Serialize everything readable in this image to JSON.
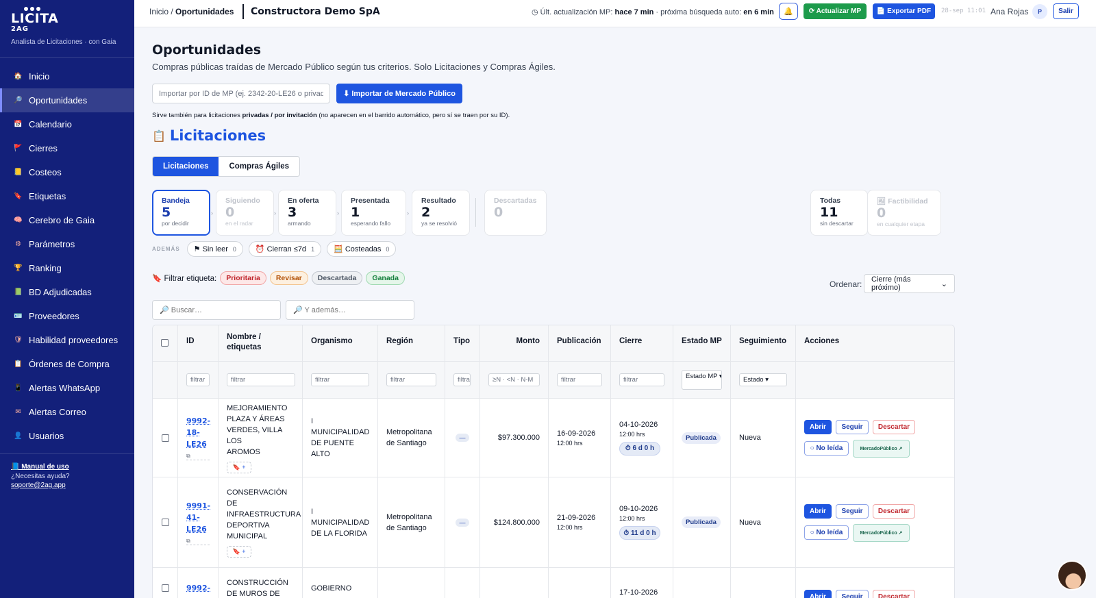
{
  "brand": {
    "name": "LICITA",
    "sub": "2AG",
    "tagline": "Analista de Licitaciones · con Gaia"
  },
  "sidebar": {
    "items": [
      {
        "label": "Inicio",
        "icon": "home-icon",
        "glyph": "🏠"
      },
      {
        "label": "Oportunidades",
        "icon": "search-icon",
        "glyph": "🔎",
        "active": true
      },
      {
        "label": "Calendario",
        "icon": "calendar-icon",
        "glyph": "📅"
      },
      {
        "label": "Cierres",
        "icon": "flag-icon",
        "glyph": "🚩"
      },
      {
        "label": "Costeos",
        "icon": "ledger-icon",
        "glyph": "📒"
      },
      {
        "label": "Etiquetas",
        "icon": "bookmark-icon",
        "glyph": "🔖"
      },
      {
        "label": "Cerebro de Gaia",
        "icon": "brain-icon",
        "glyph": "🧠"
      },
      {
        "label": "Parámetros",
        "icon": "gear-icon",
        "glyph": "⚙"
      },
      {
        "label": "Ranking",
        "icon": "trophy-icon",
        "glyph": "🏆"
      },
      {
        "label": "BD Adjudicadas",
        "icon": "document-icon",
        "glyph": "📗"
      },
      {
        "label": "Proveedores",
        "icon": "id-card-icon",
        "glyph": "🪪"
      },
      {
        "label": "Habilidad proveedores",
        "icon": "shield-icon",
        "glyph": "🛡"
      },
      {
        "label": "Órdenes de Compra",
        "icon": "receipt-icon",
        "glyph": "📋"
      },
      {
        "label": "Alertas WhatsApp",
        "icon": "phone-icon",
        "glyph": "📱"
      },
      {
        "label": "Alertas Correo",
        "icon": "mail-icon",
        "glyph": "✉"
      },
      {
        "label": "Usuarios",
        "icon": "user-icon",
        "glyph": "👤"
      }
    ],
    "footer": {
      "manual": "📘 Manual de uso",
      "help": "¿Necesitas ayuda?",
      "email": "soporte@2ag.app"
    }
  },
  "topbar": {
    "breadcrumb_home": "Inicio",
    "breadcrumb_sep": "/",
    "breadcrumb_current": "Oportunidades",
    "company": "Constructora Demo SpA",
    "update_prefix": "◷ Últ. actualización MP:",
    "update_ago": "hace 7 min",
    "update_mid": "· próxima búsqueda auto:",
    "update_next": "en 6 min",
    "bell": "🔔",
    "update_btn": "⟳ Actualizar MP",
    "export_btn": "📄 Exportar PDF",
    "clock": "28-sep 11:01",
    "user": "Ana Rojas",
    "avatar_initial": "P",
    "logout": "Salir"
  },
  "page": {
    "title": "Oportunidades",
    "subtitle": "Compras públicas traídas de Mercado Público según tus criterios. Solo Licitaciones y Compras Ágiles.",
    "import_placeholder": "Importar por ID de MP (ej. 2342-20-LE26 o privada",
    "import_btn": "⬇ Importar de Mercado Público",
    "help_pre": "Sirve también para licitaciones ",
    "help_bold": "privadas / por invitación",
    "help_post": " (no aparecen en el barrido automático, pero sí se traen por su ID).",
    "section_icon": "📋",
    "section_title": "Licitaciones",
    "tabs": [
      "Licitaciones",
      "Compras Ágiles"
    ]
  },
  "stages": [
    {
      "label": "Bandeja",
      "count": "5",
      "sub": "por decidir"
    },
    {
      "label": "Siguiendo",
      "count": "0",
      "sub": "en el radar"
    },
    {
      "label": "En oferta",
      "count": "3",
      "sub": "armando"
    },
    {
      "label": "Presentada",
      "count": "1",
      "sub": "esperando fallo"
    },
    {
      "label": "Resultado",
      "count": "2",
      "sub": "ya se resolvió"
    },
    {
      "label": "Descartadas",
      "count": "0",
      "sub": ""
    },
    {
      "label": "Todas",
      "count": "11",
      "sub": "sin descartar"
    },
    {
      "label": "🖼 Factibilidad",
      "count": "0",
      "sub": "en cualquier etapa"
    }
  ],
  "extras": {
    "label": "ADEMÁS",
    "pills": [
      {
        "label": "⚑ Sin leer",
        "count": "0"
      },
      {
        "label": "⏰ Cierran ≤7d",
        "count": "1"
      },
      {
        "label": "🧮 Costeadas",
        "count": "0"
      }
    ]
  },
  "tag_filter": {
    "label": "🔖 Filtrar etiqueta:",
    "tags": [
      "Prioritaria",
      "Revisar",
      "Descartada",
      "Ganada"
    ]
  },
  "order": {
    "label": "Ordenar:",
    "value": "Cierre (más próximo)"
  },
  "search": {
    "placeholder1": "🔎 Buscar…",
    "placeholder2": "🔎 Y además…"
  },
  "table": {
    "headers": [
      "ID",
      "Nombre / etiquetas",
      "Organismo",
      "Región",
      "Tipo",
      "Monto",
      "Publicación",
      "Cierre",
      "Estado MP",
      "Seguimiento",
      "Acciones"
    ],
    "filters": [
      "filtrar",
      "filtrar",
      "filtrar",
      "filtrar",
      "filtrar",
      "≥N · <N · N-M",
      "filtrar",
      "filtrar",
      "Estado MP ▾",
      "Estado ▾"
    ],
    "rows": [
      {
        "id_lines": [
          "9992-",
          "18-",
          "LE26"
        ],
        "name_lines": [
          "MEJORAMIENTO",
          "PLAZA Y ÁREAS",
          "VERDES, VILLA LOS",
          "AROMOS"
        ],
        "org_lines": [
          "I MUNICIPALIDAD",
          "DE PUENTE ALTO"
        ],
        "region_lines": [
          "Metropolitana",
          "de Santiago"
        ],
        "tipo": "—",
        "monto": "$97.300.000",
        "pub_date": "16-09-2026",
        "pub_time": "12:00 hrs",
        "close_date": "04-10-2026",
        "close_time": "12:00 hrs",
        "countdown": "⏱ 6 d 0 h",
        "estado": "Publicada",
        "seguimiento": "Nueva"
      },
      {
        "id_lines": [
          "9991-",
          "41-",
          "LE26"
        ],
        "name_lines": [
          "CONSERVACIÓN",
          "DE",
          "INFRAESTRUCTURA",
          "DEPORTIVA",
          "MUNICIPAL"
        ],
        "org_lines": [
          "I MUNICIPALIDAD",
          "DE LA FLORIDA"
        ],
        "region_lines": [
          "Metropolitana",
          "de Santiago"
        ],
        "tipo": "—",
        "monto": "$124.800.000",
        "pub_date": "21-09-2026",
        "pub_time": "12:00 hrs",
        "close_date": "09-10-2026",
        "close_time": "12:00 hrs",
        "countdown": "⏱ 11 d 0 h",
        "estado": "Publicada",
        "seguimiento": "Nueva"
      },
      {
        "id_lines": [
          "9992-"
        ],
        "name_lines": [
          "CONSTRUCCIÓN",
          "DE MUROS DE"
        ],
        "org_lines": [
          "GOBIERNO"
        ],
        "close_date": "17-10-2026"
      }
    ],
    "actions": {
      "open": "Abrir",
      "follow": "Seguir",
      "discard": "Descartar",
      "unread": "○ No leída",
      "mp": "MercadoPúblico ↗"
    },
    "copy_icon": "⧉",
    "add_tag": "🔖 +"
  }
}
